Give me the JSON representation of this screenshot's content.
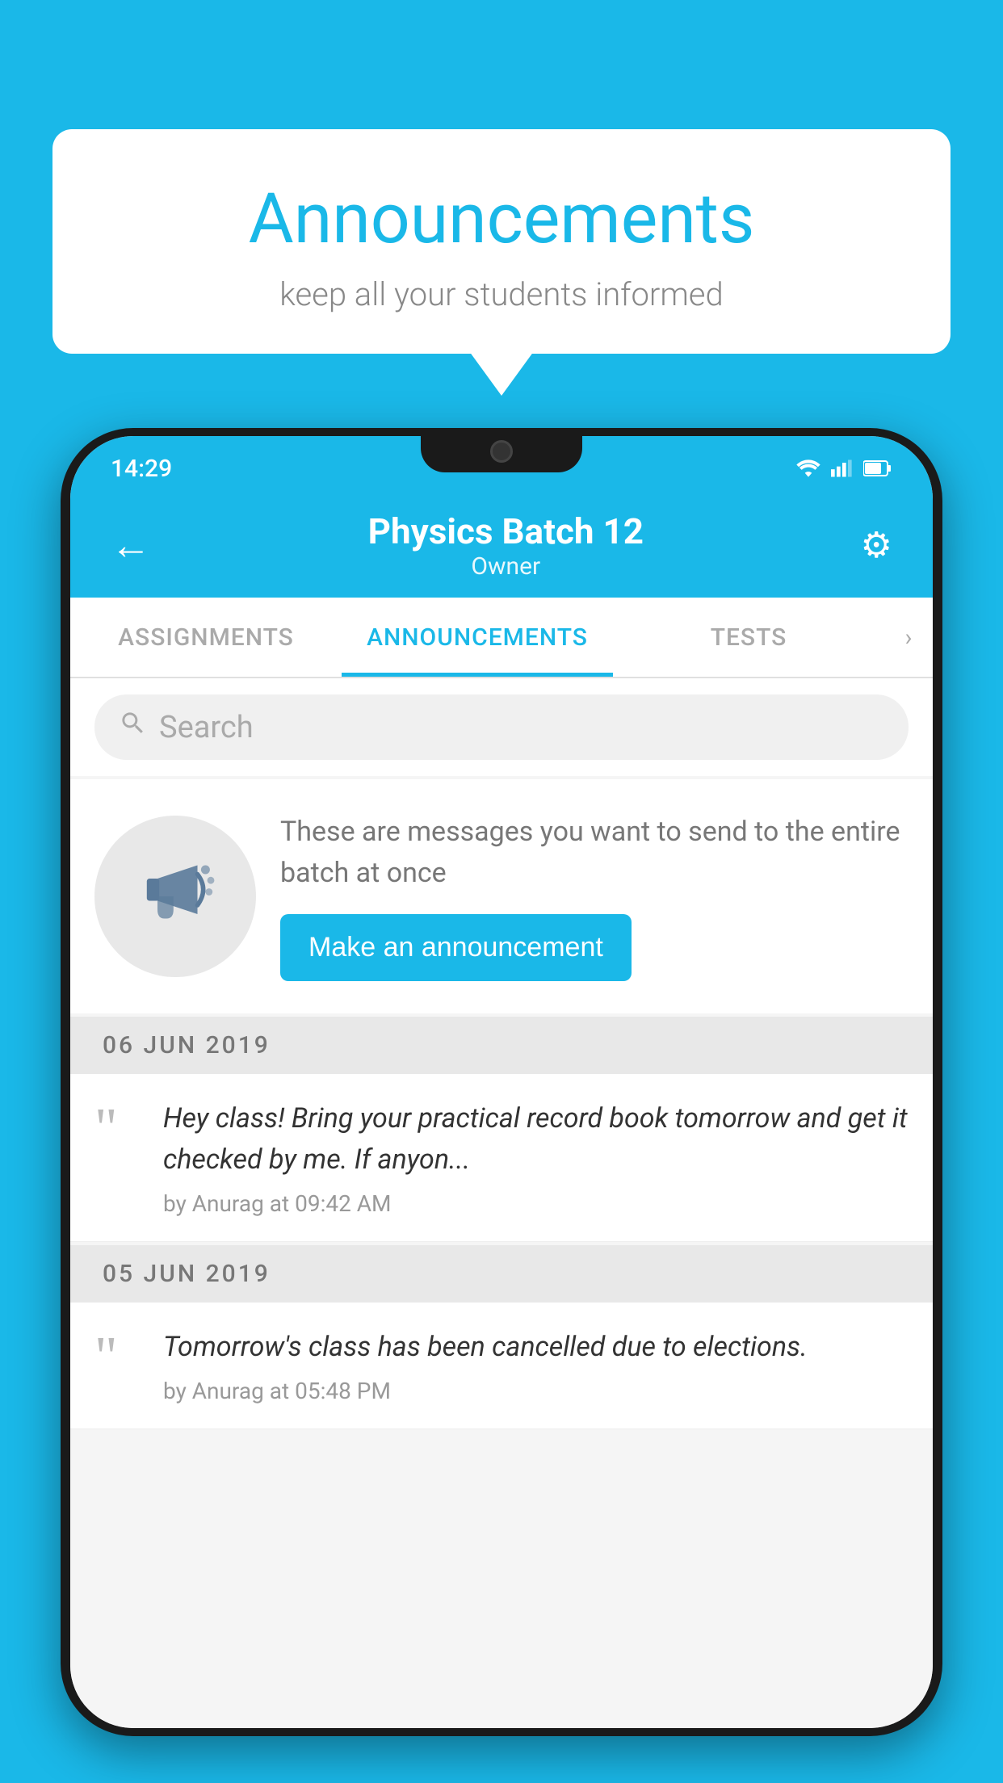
{
  "background_color": "#1ab8e8",
  "speech_bubble": {
    "title": "Announcements",
    "subtitle": "keep all your students informed"
  },
  "status_bar": {
    "time": "14:29"
  },
  "app_bar": {
    "title": "Physics Batch 12",
    "subtitle": "Owner",
    "back_label": "←",
    "gear_label": "⚙"
  },
  "tabs": [
    {
      "label": "ASSIGNMENTS",
      "active": false
    },
    {
      "label": "ANNOUNCEMENTS",
      "active": true
    },
    {
      "label": "TESTS",
      "active": false
    }
  ],
  "search": {
    "placeholder": "Search"
  },
  "promo": {
    "description": "These are messages you want to send to the entire batch at once",
    "button_label": "Make an announcement"
  },
  "announcements": [
    {
      "date": "06  JUN  2019",
      "text": "Hey class! Bring your practical record book tomorrow and get it checked by me. If anyon...",
      "meta": "by Anurag at 09:42 AM"
    },
    {
      "date": "05  JUN  2019",
      "text": "Tomorrow's class has been cancelled due to elections.",
      "meta": "by Anurag at 05:48 PM"
    }
  ]
}
